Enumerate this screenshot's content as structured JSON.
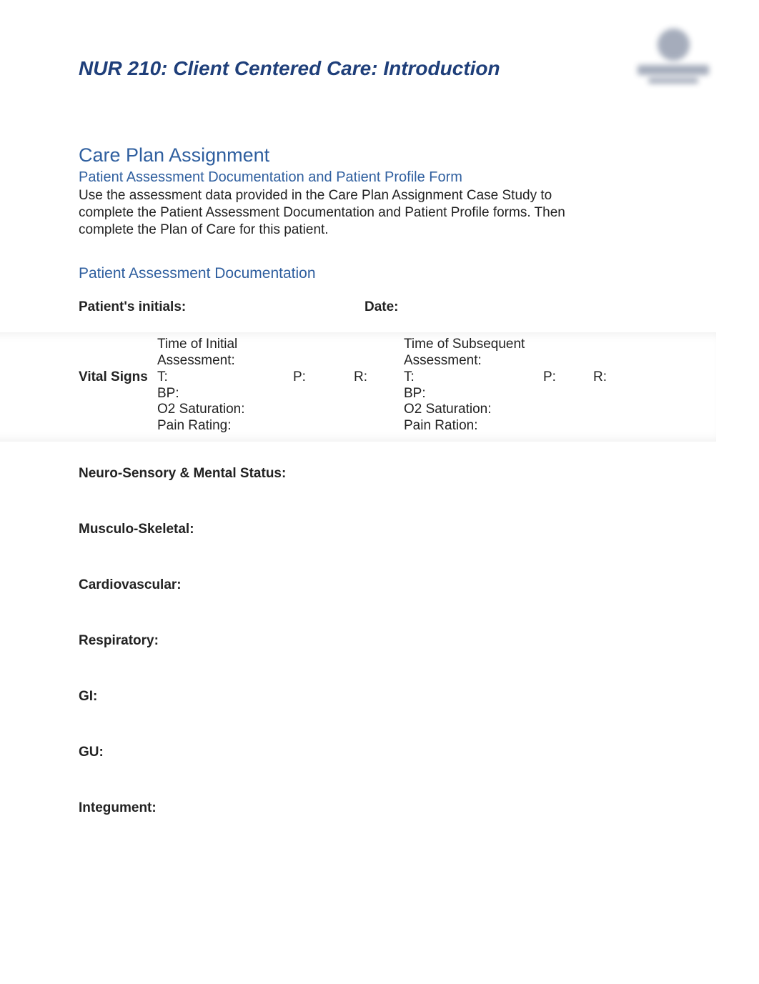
{
  "course_title": "NUR 210: Client Centered Care: Introduction",
  "assignment_heading": "Care Plan Assignment",
  "subtitle": "Patient Assessment Documentation and Patient Profile Form",
  "instructions": "Use the assessment data provided in the Care Plan Assignment Case Study to complete the Patient Assessment Documentation and Patient Profile forms. Then complete the Plan of Care for this patient.",
  "section_heading": "Patient Assessment Documentation",
  "labels": {
    "patient_initials": "Patient's initials:",
    "date": "Date:",
    "vital_signs": "Vital Signs",
    "time_initial": "Time of Initial Assessment:",
    "time_subsequent": "Time of Subsequent Assessment:",
    "t": "T:",
    "p": "P:",
    "r": "R:",
    "bp": "BP:",
    "o2": "O2 Saturation:",
    "pain_rating": "Pain Rating:",
    "pain_ration": "Pain Ration:"
  },
  "assessment_sections": {
    "neuro": "Neuro-Sensory & Mental Status:",
    "musculo": "Musculo-Skeletal:",
    "cardio": "Cardiovascular:",
    "resp": "Respiratory:",
    "gi": "GI:",
    "gu": "GU:",
    "integ": "Integument:"
  }
}
